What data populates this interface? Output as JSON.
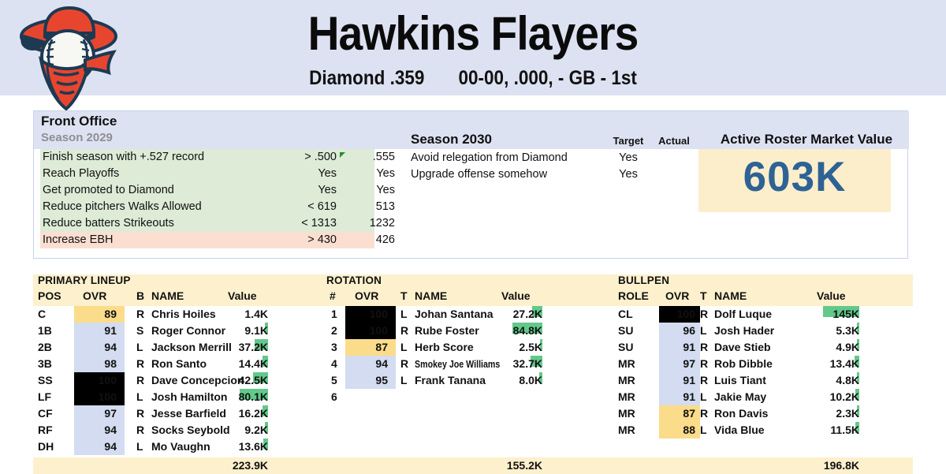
{
  "header": {
    "team_name": "Hawkins Flayers",
    "league": "Diamond .359",
    "record": "00-00, .000, - GB - 1st",
    "logo_icon": "baseball-bandit-logo"
  },
  "front_office": {
    "title": "Front Office",
    "season_label": "Season 2029",
    "goals_2029": [
      {
        "label": "Finish season with +.527 record",
        "target": "> .500",
        "actual": ".555",
        "met": true,
        "flag": true
      },
      {
        "label": "Reach Playoffs",
        "target": "Yes",
        "actual": "Yes",
        "met": true,
        "flag": false
      },
      {
        "label": "Get promoted to Diamond",
        "target": "Yes",
        "actual": "Yes",
        "met": true,
        "flag": false
      },
      {
        "label": "Reduce pitchers Walks Allowed",
        "target": "< 619",
        "actual": "513",
        "met": true,
        "flag": false
      },
      {
        "label": "Reduce batters Strikeouts",
        "target": "< 1313",
        "actual": "1232",
        "met": true,
        "flag": false
      },
      {
        "label": "Increase EBH",
        "target": "> 430",
        "actual": "426",
        "met": false,
        "flag": false
      }
    ],
    "season_2030": {
      "title": "Season 2030",
      "col_target": "Target",
      "col_actual": "Actual",
      "goals": [
        {
          "label": "Avoid relegation from Diamond",
          "target": "Yes",
          "actual": ""
        },
        {
          "label": "Upgrade offense somehow",
          "target": "Yes",
          "actual": ""
        }
      ]
    },
    "market_value": {
      "title": "Active Roster Market Value",
      "value": "603K"
    }
  },
  "lineup": {
    "title": "PRIMARY LINEUP",
    "columns": [
      "POS",
      "OVR",
      "B",
      "NAME",
      "Value"
    ],
    "rows": [
      {
        "pos": "C",
        "ovr": "89",
        "ovr_tier": "mid",
        "bat": "R",
        "name": "Chris Hoiles",
        "value": "1.4K",
        "bar": 0
      },
      {
        "pos": "1B",
        "ovr": "91",
        "ovr_tier": "high",
        "bat": "S",
        "name": "Roger Connor",
        "value": "9.1K",
        "bar": 4
      },
      {
        "pos": "2B",
        "ovr": "94",
        "ovr_tier": "high",
        "bat": "L",
        "name": "Jackson Merrill",
        "value": "37.2K",
        "bar": 17
      },
      {
        "pos": "3B",
        "ovr": "98",
        "ovr_tier": "high",
        "bat": "R",
        "name": "Ron Santo",
        "value": "14.4K",
        "bar": 7
      },
      {
        "pos": "SS",
        "ovr": "100",
        "ovr_tier": "elite",
        "bat": "R",
        "name": "Dave Concepcion",
        "value": "42.5K",
        "bar": 19
      },
      {
        "pos": "LF",
        "ovr": "100",
        "ovr_tier": "elite",
        "bat": "L",
        "name": "Josh Hamilton",
        "value": "80.1K",
        "bar": 36
      },
      {
        "pos": "CF",
        "ovr": "97",
        "ovr_tier": "high",
        "bat": "R",
        "name": "Jesse Barfield",
        "value": "16.2K",
        "bar": 7
      },
      {
        "pos": "RF",
        "ovr": "94",
        "ovr_tier": "high",
        "bat": "R",
        "name": "Socks Seybold",
        "value": "9.2K",
        "bar": 4
      },
      {
        "pos": "DH",
        "ovr": "94",
        "ovr_tier": "high",
        "bat": "L",
        "name": "Mo Vaughn",
        "value": "13.6K",
        "bar": 6
      }
    ],
    "total": "223.9K"
  },
  "rotation": {
    "title": "ROTATION",
    "columns": [
      "#",
      "OVR",
      "T",
      "NAME",
      "Value"
    ],
    "rows": [
      {
        "num": "1",
        "ovr": "100",
        "ovr_tier": "elite",
        "throws": "L",
        "name": "Johan Santana",
        "value": "27.2K",
        "bar": 13,
        "condensed": false
      },
      {
        "num": "2",
        "ovr": "100",
        "ovr_tier": "elite",
        "throws": "R",
        "name": "Rube Foster",
        "value": "84.8K",
        "bar": 38,
        "condensed": false
      },
      {
        "num": "3",
        "ovr": "87",
        "ovr_tier": "mid",
        "throws": "L",
        "name": "Herb Score",
        "value": "2.5K",
        "bar": 3,
        "condensed": false
      },
      {
        "num": "4",
        "ovr": "94",
        "ovr_tier": "high",
        "throws": "R",
        "name": "Smokey Joe Williams",
        "value": "32.7K",
        "bar": 15,
        "condensed": true
      },
      {
        "num": "5",
        "ovr": "95",
        "ovr_tier": "high",
        "throws": "L",
        "name": "Frank Tanana",
        "value": "8.0K",
        "bar": 4,
        "condensed": false
      },
      {
        "num": "6",
        "ovr": "",
        "ovr_tier": "blank",
        "throws": "",
        "name": "",
        "value": "",
        "bar": 0,
        "condensed": false
      }
    ],
    "total": "155.2K"
  },
  "bullpen": {
    "title": "BULLPEN",
    "columns": [
      "ROLE",
      "OVR",
      "T",
      "NAME",
      "Value"
    ],
    "rows": [
      {
        "role": "CL",
        "ovr": "100",
        "ovr_tier": "elite",
        "throws": "R",
        "name": "Dolf Luque",
        "value": "145K",
        "bar": 46
      },
      {
        "role": "SU",
        "ovr": "96",
        "ovr_tier": "high",
        "throws": "L",
        "name": "Josh Hader",
        "value": "5.3K",
        "bar": 3
      },
      {
        "role": "SU",
        "ovr": "91",
        "ovr_tier": "high",
        "throws": "R",
        "name": "Dave Stieb",
        "value": "4.9K",
        "bar": 3
      },
      {
        "role": "MR",
        "ovr": "97",
        "ovr_tier": "high",
        "throws": "R",
        "name": "Rob Dibble",
        "value": "13.4K",
        "bar": 6
      },
      {
        "role": "MR",
        "ovr": "91",
        "ovr_tier": "high",
        "throws": "R",
        "name": "Luis Tiant",
        "value": "4.8K",
        "bar": 3
      },
      {
        "role": "MR",
        "ovr": "91",
        "ovr_tier": "high",
        "throws": "L",
        "name": "Jakie May",
        "value": "10.2K",
        "bar": 5
      },
      {
        "role": "MR",
        "ovr": "87",
        "ovr_tier": "mid",
        "throws": "R",
        "name": "Ron Davis",
        "value": "2.3K",
        "bar": 3
      },
      {
        "role": "MR",
        "ovr": "88",
        "ovr_tier": "mid",
        "throws": "L",
        "name": "Vida Blue",
        "value": "11.5K",
        "bar": 5
      }
    ],
    "total": "196.8K"
  },
  "colors": {
    "header_bg": "#dde2f2",
    "cream": "#fdf0cd",
    "goal_met": "#ddebd7",
    "goal_miss": "#fadfd1",
    "bar_green": "#62c98b",
    "ovr_elite_bg": "#000000",
    "ovr_high_bg": "#d3dcf0",
    "ovr_mid_bg": "#fbdc8a",
    "market_value_text": "#2e6295"
  }
}
